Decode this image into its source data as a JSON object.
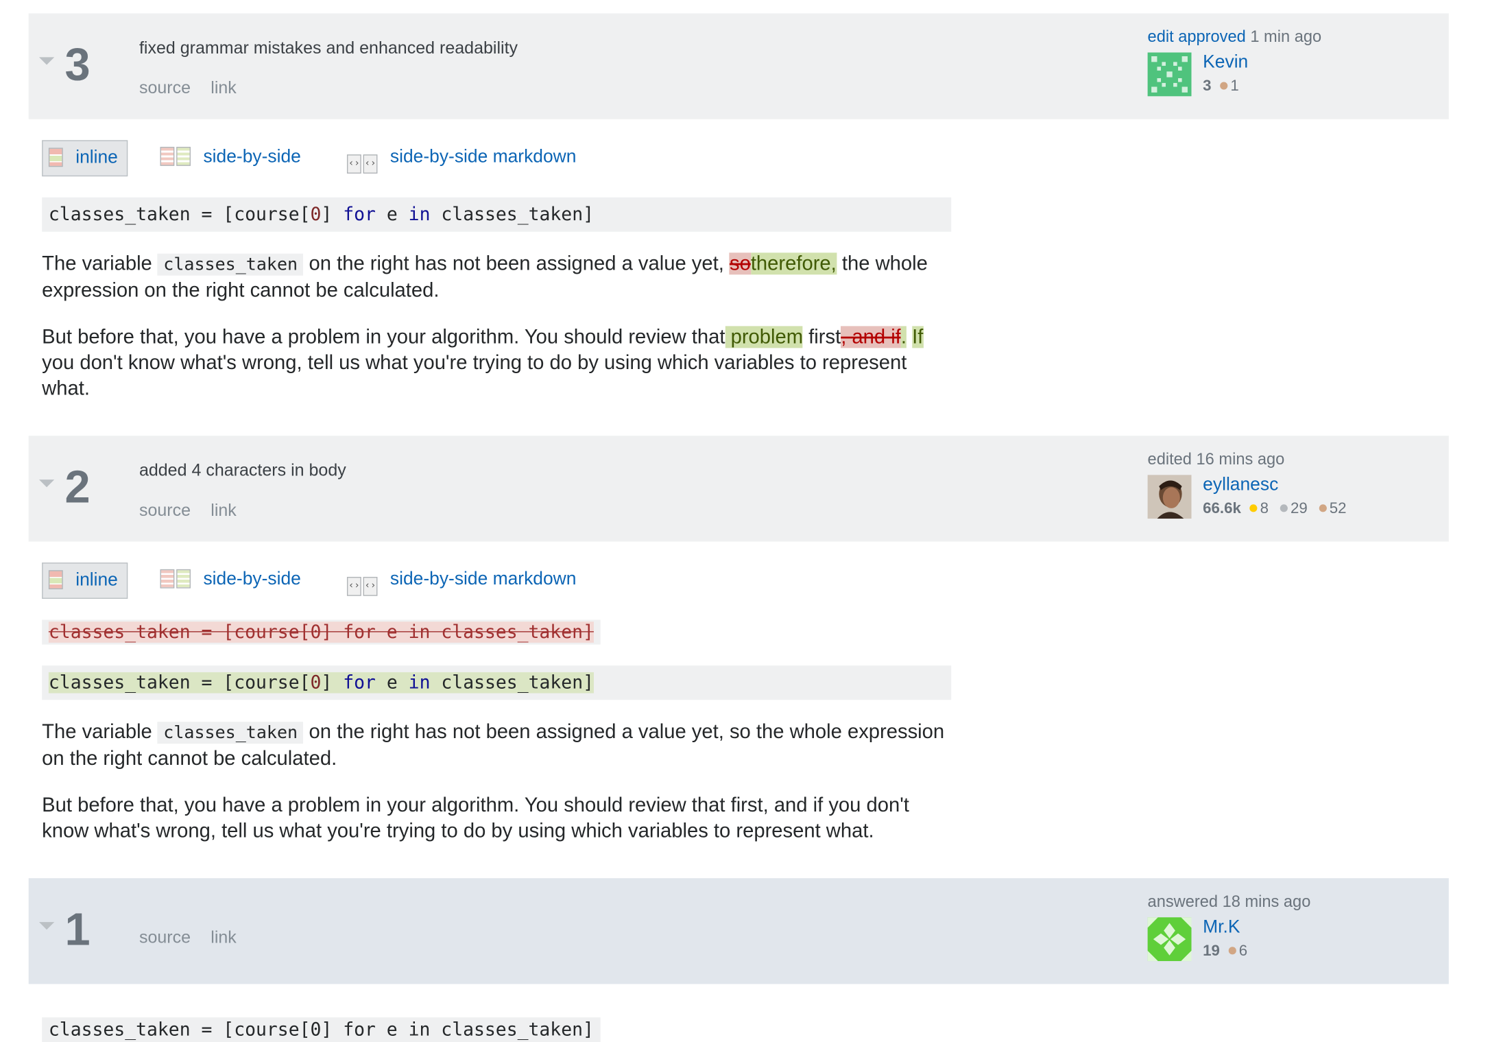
{
  "revisions": [
    {
      "number": "3",
      "comment": "fixed grammar mistakes and enhanced readability",
      "links": {
        "source": "source",
        "link": "link"
      },
      "action_link": "edit approved",
      "time": "1 min ago",
      "user": {
        "name": "Kevin",
        "rep": "3",
        "bronze": "1"
      },
      "tabs": {
        "inline": "inline",
        "side_by_side": "side-by-side",
        "side_by_side_markdown": "side-by-side markdown"
      },
      "code": {
        "var": "classes_taken = [course[",
        "num": "0",
        "mid": "] ",
        "for": "for",
        "e": " e ",
        "in": "in",
        "end": " classes_taken]"
      },
      "p1": {
        "a": "The variable ",
        "code": "classes_taken",
        "b": " on the right has not been assigned a value yet, ",
        "del": "so",
        "ins": "therefore,",
        "c": " the whole expression on the right cannot be calculated."
      },
      "p2": {
        "a": "But before that, you have a problem in your algorithm. You should review that",
        "ins1": " problem",
        "b": " first",
        "del": ", and if",
        "ins2": ".",
        "ins3": "If",
        "c": " you don't know what's wrong, tell us what you're trying to do by using which variables to represent what."
      }
    },
    {
      "number": "2",
      "comment": "added 4 characters in body",
      "links": {
        "source": "source",
        "link": "link"
      },
      "action": "edited",
      "time": "16 mins ago",
      "user": {
        "name": "eyllanesc",
        "rep": "66.6k",
        "gold": "8",
        "silver": "29",
        "bronze": "52"
      },
      "tabs": {
        "inline": "inline",
        "side_by_side": "side-by-side",
        "side_by_side_markdown": "side-by-side markdown"
      },
      "code_old": "classes_taken = [course[0] for e in classes_taken]",
      "p1": {
        "a": "The variable ",
        "code": "classes_taken",
        "b": " on the right has not been assigned a value yet, so the whole expression on the right cannot be calculated."
      },
      "p2": "But before that, you have a problem in your algorithm. You should review that first, and if you don't know what's wrong, tell us what you're trying to do by using which variables to represent what."
    },
    {
      "number": "1",
      "links": {
        "source": "source",
        "link": "link"
      },
      "action": "answered",
      "time": "18 mins ago",
      "user": {
        "name": "Mr.K",
        "rep": "19",
        "bronze": "6"
      },
      "code_partial": "classes_taken = [course[0] for e in classes_taken]"
    }
  ],
  "icons": {
    "collapse": "collapse-arrow-icon",
    "inline": "inline-diff-icon",
    "side_by_side": "side-by-side-icon",
    "markdown": "markdown-diff-icon"
  },
  "colors": {
    "link": "#0c65b5",
    "inserted_bg": "#d1e1ad",
    "deleted_bg": "#e7c0bb",
    "header_bg": "#eff0f1",
    "answered_bg": "#e1e6ec"
  }
}
